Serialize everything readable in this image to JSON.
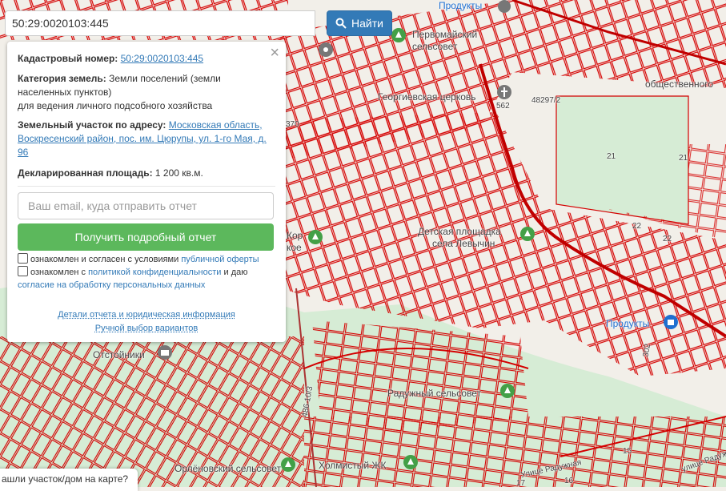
{
  "search": {
    "value": "50:29:0020103:445",
    "button_label": "Найти"
  },
  "panel": {
    "cadastral_label": "Кадастровый номер:",
    "cadastral_value": "50:29:0020103:445",
    "category_label": "Категория земель:",
    "category_value_line1": "Земли поселений (земли",
    "category_value_line2": "населенных пунктов)",
    "category_value_line3": "для ведения личного подсобного хозяйства",
    "address_label": "Земельный участок по адресу:",
    "address_line1": "Московская область,",
    "address_line2": "Воскресенский район, пос. им. Цюрупы, ул. 1-го Мая, д.",
    "address_line3": "96",
    "area_label": "Декларированная площадь:",
    "area_value": "1 200 кв.м.",
    "email_placeholder": "Ваш email, куда отправить отчет",
    "report_button": "Получить подробный отчет",
    "terms1_text": "ознакомлен и согласен с условиями",
    "terms1_link": "публичной оферты",
    "terms2_text1": "ознакомлен с",
    "terms2_link1": "политикой конфиденциальности",
    "terms2_text2": "и даю",
    "terms2_link2": "согласие на обработку персональных данных",
    "details_link": "Детали отчета и юридическая информация",
    "manual_link": "Ручной выбор вариантов"
  },
  "map_labels": {
    "pervomaysky": "Первомайский",
    "selsovet": "сельсовет",
    "georgievskaya": "Георгиевская церковь",
    "produkty_top": "Продукты",
    "obshchestvennogo": "общественного",
    "num_562": "562",
    "num_48297": "48297/2",
    "num_21a": "21",
    "num_21b": "21",
    "num_22a": "22",
    "num_22b": "22",
    "num_370": "370",
    "detskaya1": "Детская площадка",
    "detskaya2": "села Левычин",
    "kor": "Кор",
    "koe": "кое",
    "produkty": "Продукты",
    "num_302": "302",
    "otstoyniki": "Отстойники",
    "raduzhny": "Радужный сельсовет",
    "num_486": "486 10/3",
    "orlenovsky": "Орлёновский сельсовет",
    "kholmisty": "Холмистый ЖК",
    "raduzhnaya": "Улице Радужная",
    "ulitse_raduzhnaya": "улице Радужная",
    "num_15": "15",
    "num_16": "16",
    "num_17": "17"
  },
  "bottom_tab": "ашли участок/дом на карте?",
  "colors": {
    "parcel_line": "#d40000",
    "greens": "#cfe8d0",
    "button_blue": "#337ab7",
    "button_green": "#5cb85c"
  }
}
